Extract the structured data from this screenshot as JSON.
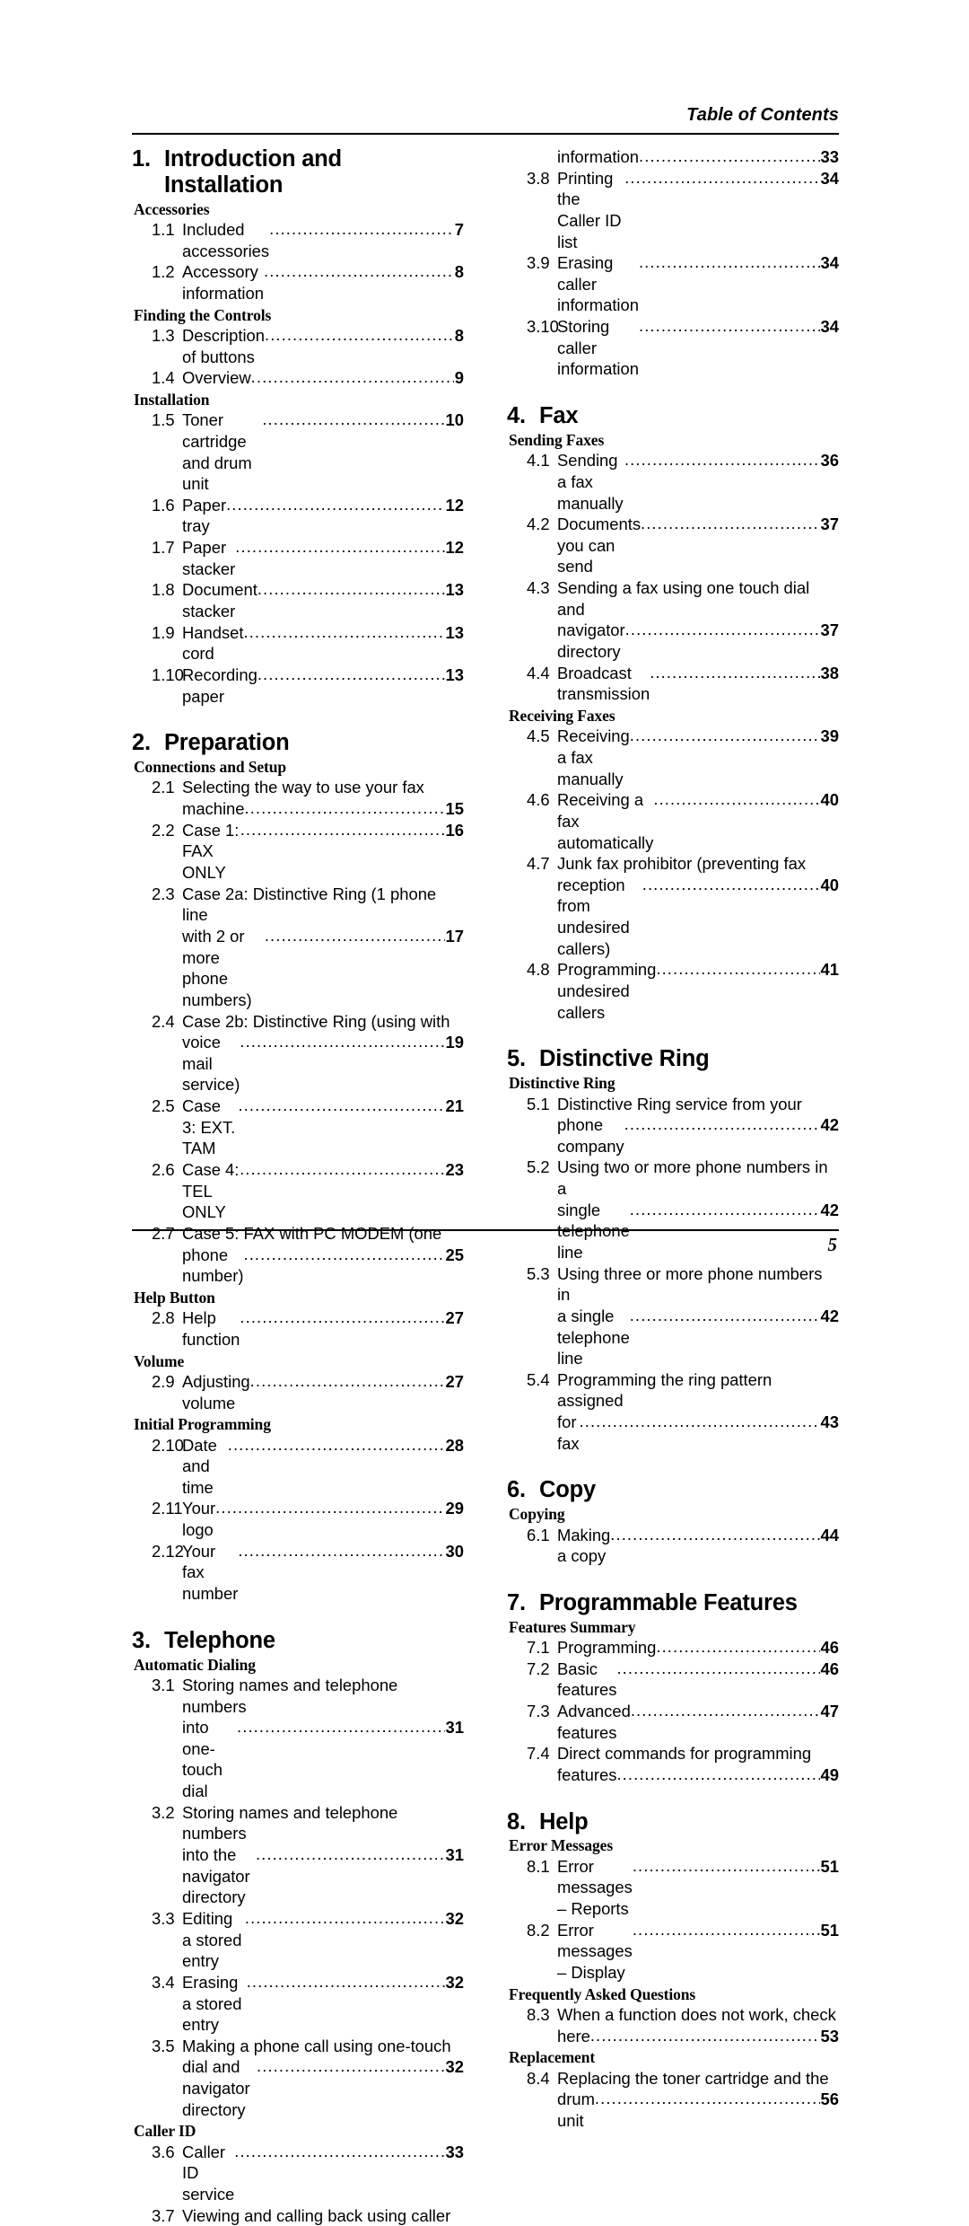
{
  "header": {
    "title": "Table of Contents"
  },
  "footer": {
    "page_number": "5"
  },
  "columns": [
    {
      "name": "left-column",
      "blocks": [
        {
          "type": "chapter",
          "number": "1.",
          "title": "Introduction and Installation"
        },
        {
          "type": "group",
          "label": "Accessories"
        },
        {
          "type": "entry",
          "number": "1.1",
          "lines": [
            "Included accessories"
          ],
          "page": "7"
        },
        {
          "type": "entry",
          "number": "1.2",
          "lines": [
            "Accessory information "
          ],
          "page": "8"
        },
        {
          "type": "group",
          "label": "Finding the Controls"
        },
        {
          "type": "entry",
          "number": "1.3",
          "lines": [
            "Description of buttons"
          ],
          "page": "8"
        },
        {
          "type": "entry",
          "number": "1.4",
          "lines": [
            "Overview "
          ],
          "page": "9"
        },
        {
          "type": "group",
          "label": "Installation"
        },
        {
          "type": "entry",
          "number": "1.5",
          "lines": [
            "Toner cartridge and drum unit  "
          ],
          "page": "10"
        },
        {
          "type": "entry",
          "number": "1.6",
          "lines": [
            "Paper tray "
          ],
          "page": "12"
        },
        {
          "type": "entry",
          "number": "1.7",
          "lines": [
            "Paper stacker"
          ],
          "page": "12"
        },
        {
          "type": "entry",
          "number": "1.8",
          "lines": [
            "Document stacker"
          ],
          "page": "13"
        },
        {
          "type": "entry",
          "number": "1.9",
          "lines": [
            "Handset cord "
          ],
          "page": "13"
        },
        {
          "type": "entry",
          "number": "1.10",
          "lines": [
            "Recording paper"
          ],
          "page": "13"
        },
        {
          "type": "chapter",
          "number": "2.",
          "title": "Preparation"
        },
        {
          "type": "group",
          "label": "Connections and Setup"
        },
        {
          "type": "entry",
          "number": "2.1",
          "lines": [
            "Selecting the way to use your fax",
            "machine"
          ],
          "page": "15"
        },
        {
          "type": "entry",
          "number": "2.2",
          "lines": [
            "Case 1: FAX ONLY "
          ],
          "page": "16"
        },
        {
          "type": "entry",
          "number": "2.3",
          "lines": [
            "Case 2a: Distinctive Ring (1 phone line",
            "with 2 or more phone numbers) "
          ],
          "page": "17"
        },
        {
          "type": "entry",
          "number": "2.4",
          "lines": [
            "Case 2b: Distinctive Ring (using with",
            "voice mail service)"
          ],
          "page": "19"
        },
        {
          "type": "entry",
          "number": "2.5",
          "lines": [
            "Case 3: EXT. TAM "
          ],
          "page": "21"
        },
        {
          "type": "entry",
          "number": "2.6",
          "lines": [
            "Case 4: TEL ONLY "
          ],
          "page": "23"
        },
        {
          "type": "entry",
          "number": "2.7",
          "lines": [
            "Case 5: FAX with PC MODEM (one",
            "phone number) "
          ],
          "page": "25"
        },
        {
          "type": "group",
          "label": "Help Button"
        },
        {
          "type": "entry",
          "number": "2.8",
          "lines": [
            "Help function "
          ],
          "page": "27"
        },
        {
          "type": "group",
          "label": "Volume"
        },
        {
          "type": "entry",
          "number": "2.9",
          "lines": [
            "Adjusting volume "
          ],
          "page": "27"
        },
        {
          "type": "group",
          "label": "Initial Programming"
        },
        {
          "type": "entry",
          "number": "2.10",
          "lines": [
            "Date and time "
          ],
          "page": "28"
        },
        {
          "type": "entry",
          "number": "2.11",
          "lines": [
            "Your logo"
          ],
          "page": "29"
        },
        {
          "type": "entry",
          "number": "2.12",
          "lines": [
            "Your fax number "
          ],
          "page": "30"
        },
        {
          "type": "chapter",
          "number": "3.",
          "title": "Telephone"
        },
        {
          "type": "group",
          "label": "Automatic Dialing"
        },
        {
          "type": "entry",
          "number": "3.1",
          "lines": [
            "Storing names and telephone numbers",
            "into one-touch dial"
          ],
          "page": "31"
        },
        {
          "type": "entry",
          "number": "3.2",
          "lines": [
            "Storing names and telephone numbers",
            "into the navigator directory "
          ],
          "page": "31"
        },
        {
          "type": "entry",
          "number": "3.3",
          "lines": [
            "Editing a stored entry "
          ],
          "page": "32"
        },
        {
          "type": "entry",
          "number": "3.4",
          "lines": [
            "Erasing a stored entry "
          ],
          "page": "32"
        },
        {
          "type": "entry",
          "number": "3.5",
          "lines": [
            "Making a phone call using one-touch",
            "dial and navigator directory "
          ],
          "page": "32"
        },
        {
          "type": "group",
          "label": "Caller ID"
        },
        {
          "type": "entry",
          "number": "3.6",
          "lines": [
            "Caller ID service"
          ],
          "page": "33"
        },
        {
          "type": "entry-open",
          "number": "3.7",
          "lines": [
            "Viewing and calling back using caller"
          ]
        }
      ]
    },
    {
      "name": "right-column",
      "blocks": [
        {
          "type": "entry-cont",
          "lines": [
            "information"
          ],
          "page": "33"
        },
        {
          "type": "entry",
          "number": "3.8",
          "lines": [
            "Printing the Caller ID list"
          ],
          "page": "34"
        },
        {
          "type": "entry",
          "number": "3.9",
          "lines": [
            "Erasing caller information "
          ],
          "page": "34"
        },
        {
          "type": "entry",
          "number": "3.10",
          "lines": [
            "Storing caller information"
          ],
          "page": "34"
        },
        {
          "type": "chapter",
          "number": "4.",
          "title": "Fax"
        },
        {
          "type": "group",
          "label": "Sending Faxes"
        },
        {
          "type": "entry",
          "number": "4.1",
          "lines": [
            "Sending a fax manually "
          ],
          "page": "36"
        },
        {
          "type": "entry",
          "number": "4.2",
          "lines": [
            "Documents you can send"
          ],
          "page": "37"
        },
        {
          "type": "entry",
          "number": "4.3",
          "lines": [
            "Sending a fax using one touch dial and",
            "navigator directory "
          ],
          "page": "37"
        },
        {
          "type": "entry",
          "number": "4.4",
          "lines": [
            "Broadcast transmission "
          ],
          "page": "38"
        },
        {
          "type": "group",
          "label": "Receiving Faxes"
        },
        {
          "type": "entry",
          "number": "4.5",
          "lines": [
            "Receiving a fax manually"
          ],
          "page": "39"
        },
        {
          "type": "entry",
          "number": "4.6",
          "lines": [
            "Receiving a fax automatically "
          ],
          "page": "40"
        },
        {
          "type": "entry",
          "number": "4.7",
          "lines": [
            "Junk fax prohibitor (preventing fax",
            "reception from undesired callers) "
          ],
          "page": "40"
        },
        {
          "type": "entry",
          "number": "4.8",
          "lines": [
            "Programming undesired callers"
          ],
          "page": "41"
        },
        {
          "type": "chapter",
          "number": "5.",
          "title": "Distinctive Ring"
        },
        {
          "type": "group",
          "label": "Distinctive Ring"
        },
        {
          "type": "entry",
          "number": "5.1",
          "lines": [
            "Distinctive Ring service from your",
            "phone company "
          ],
          "page": "42"
        },
        {
          "type": "entry",
          "number": "5.2",
          "lines": [
            "Using two or more phone numbers in a",
            "single telephone line"
          ],
          "page": "42"
        },
        {
          "type": "entry",
          "number": "5.3",
          "lines": [
            "Using three or more phone numbers in",
            "a single telephone line"
          ],
          "page": "42"
        },
        {
          "type": "entry",
          "number": "5.4",
          "lines": [
            "Programming the ring pattern assigned",
            "for fax"
          ],
          "page": "43"
        },
        {
          "type": "chapter",
          "number": "6.",
          "title": "Copy"
        },
        {
          "type": "group",
          "label": "Copying"
        },
        {
          "type": "entry",
          "number": "6.1",
          "lines": [
            "Making a copy "
          ],
          "page": "44"
        },
        {
          "type": "chapter",
          "number": "7.",
          "title": "Programmable Features"
        },
        {
          "type": "group",
          "label": "Features Summary"
        },
        {
          "type": "entry",
          "number": "7.1",
          "lines": [
            "Programming"
          ],
          "page": "46"
        },
        {
          "type": "entry",
          "number": "7.2",
          "lines": [
            "Basic features"
          ],
          "page": "46"
        },
        {
          "type": "entry",
          "number": "7.3",
          "lines": [
            "Advanced features"
          ],
          "page": "47"
        },
        {
          "type": "entry",
          "number": "7.4",
          "lines": [
            "Direct commands for programming",
            "features"
          ],
          "page": "49"
        },
        {
          "type": "chapter",
          "number": "8.",
          "title": "Help"
        },
        {
          "type": "group",
          "label": "Error Messages"
        },
        {
          "type": "entry",
          "number": "8.1",
          "lines": [
            "Error messages – Reports "
          ],
          "page": "51"
        },
        {
          "type": "entry",
          "number": "8.2",
          "lines": [
            "Error messages – Display "
          ],
          "page": "51"
        },
        {
          "type": "group",
          "label": "Frequently Asked Questions"
        },
        {
          "type": "entry",
          "number": "8.3",
          "lines": [
            "When a function does not work, check",
            "here "
          ],
          "page": "53"
        },
        {
          "type": "group",
          "label": "Replacement"
        },
        {
          "type": "entry",
          "number": "8.4",
          "lines": [
            "Replacing the toner cartridge and the",
            "drum unit  "
          ],
          "page": "56"
        }
      ]
    }
  ]
}
